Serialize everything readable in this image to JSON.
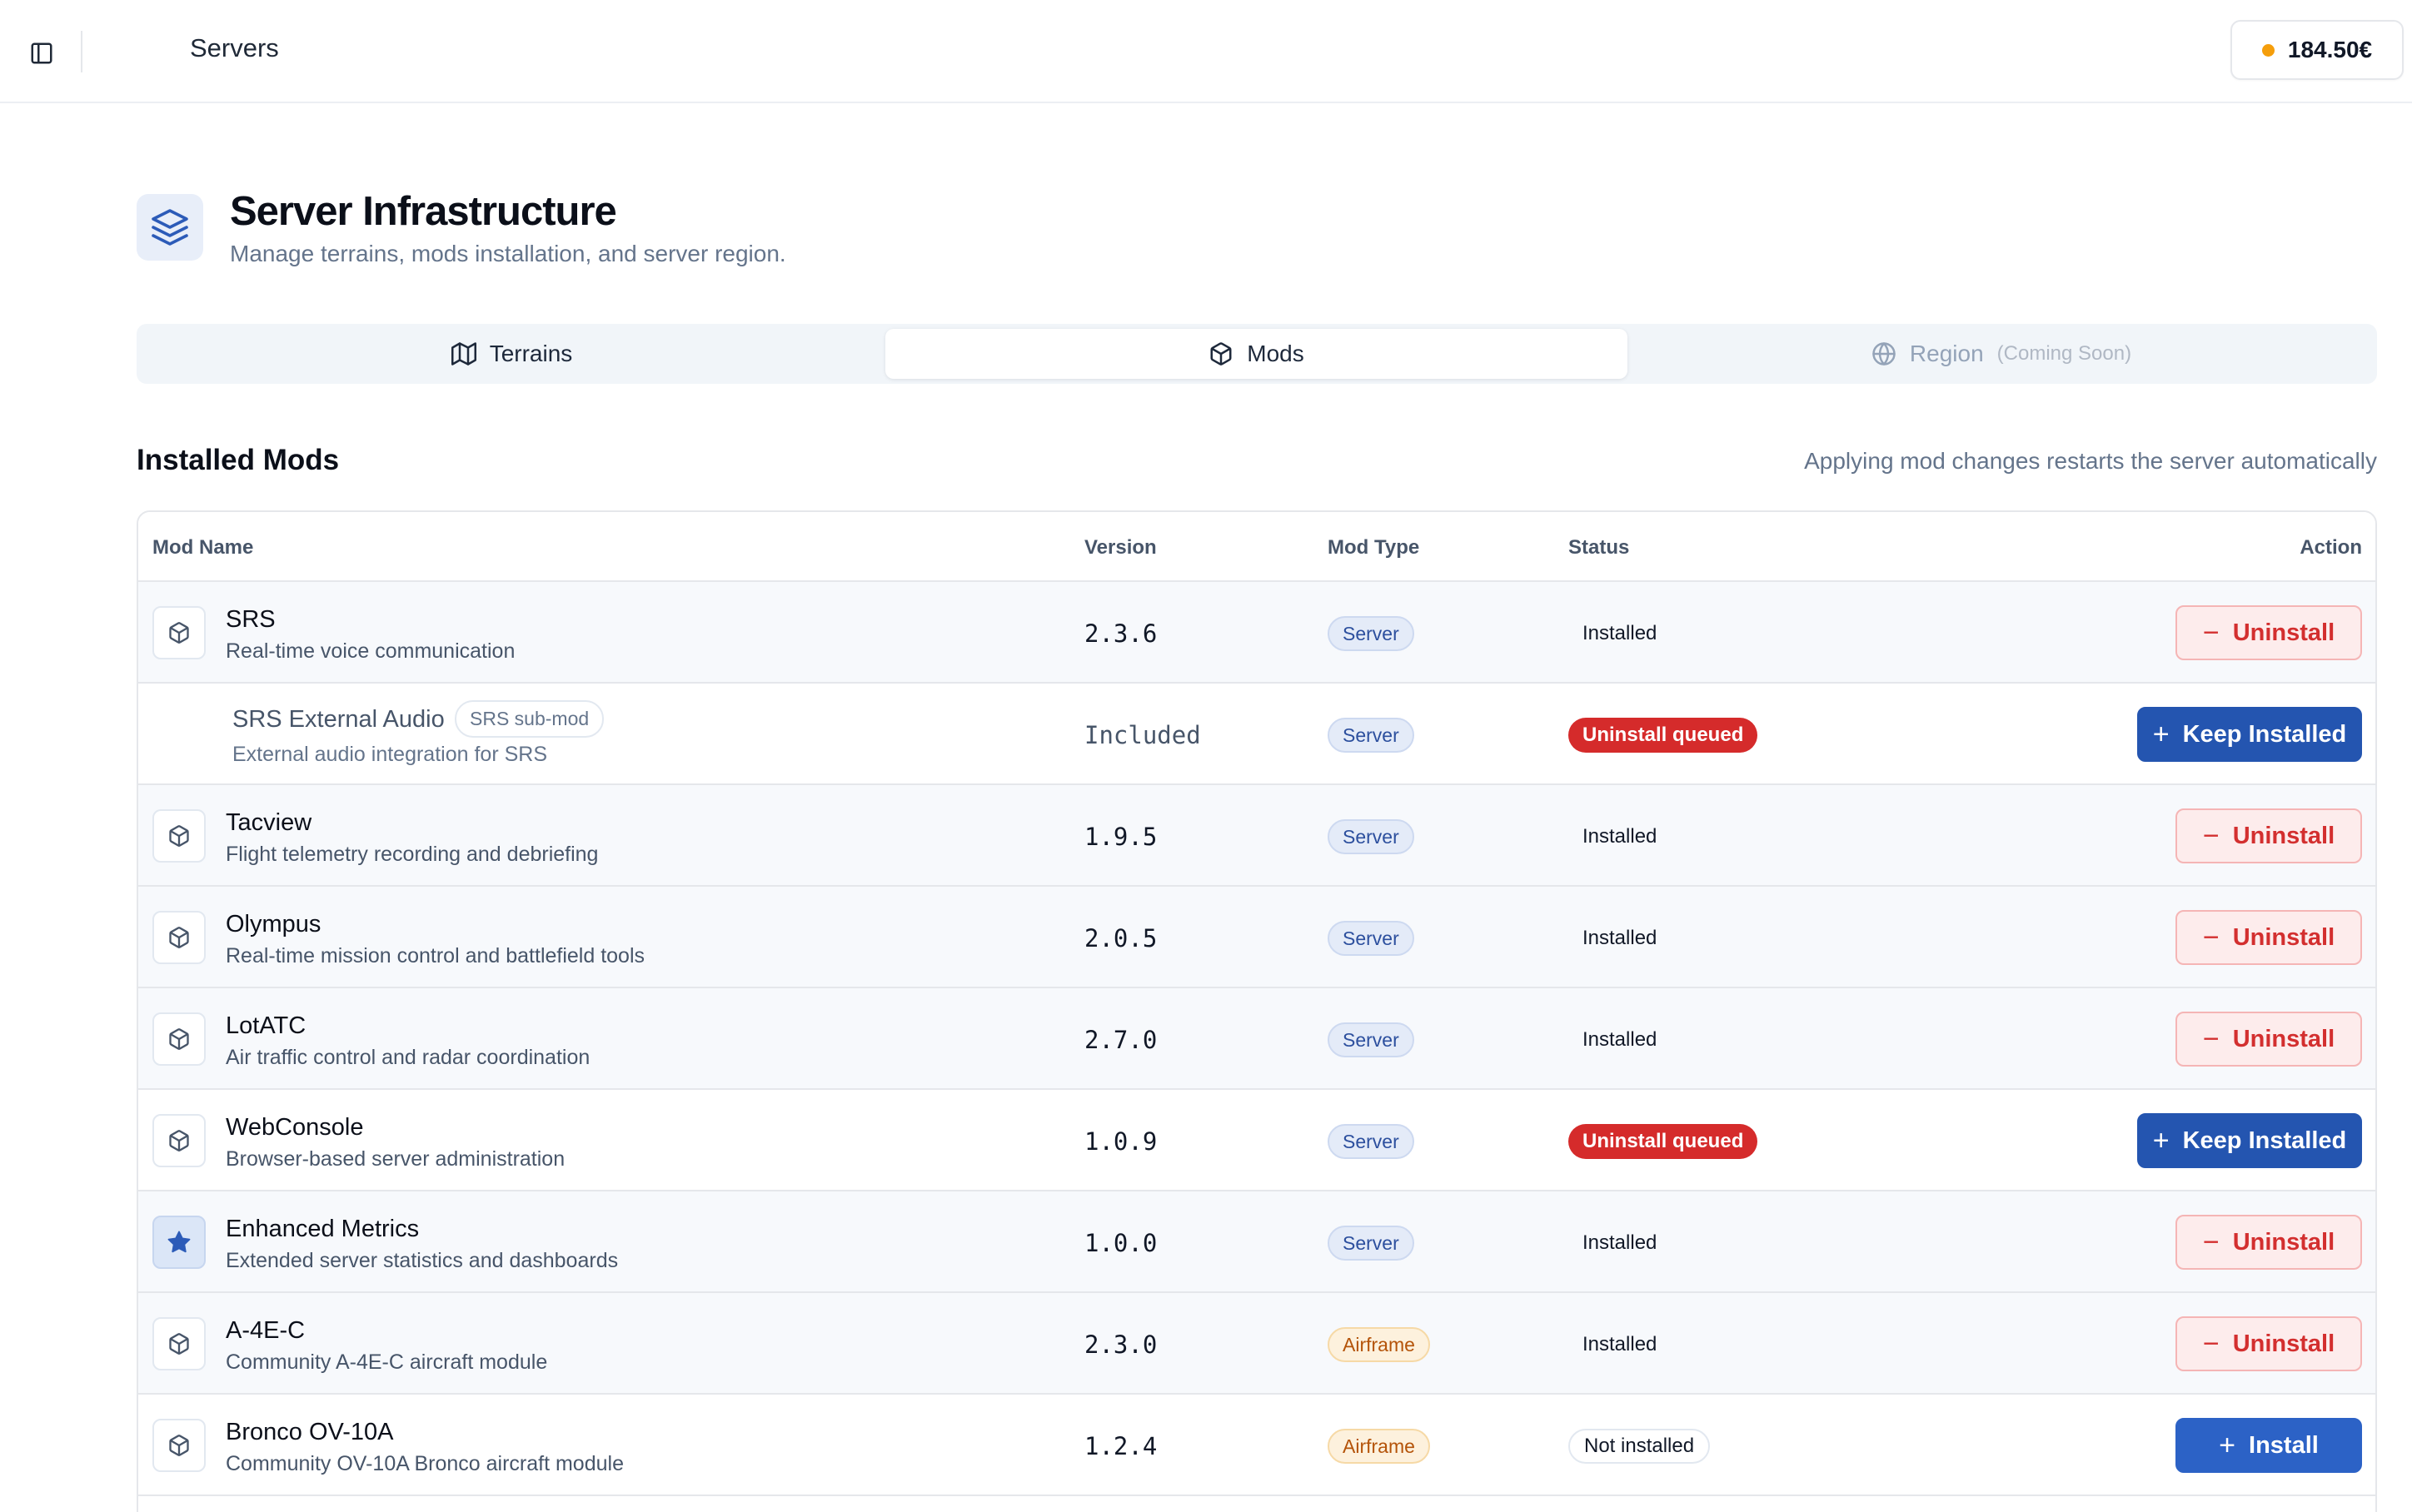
{
  "topbar": {
    "title": "Servers",
    "balance": "184.50€"
  },
  "header": {
    "title": "Server Infrastructure",
    "subtitle": "Manage terrains, mods installation, and server region."
  },
  "tabs": [
    {
      "label": "Terrains",
      "icon": "map-icon",
      "active": false
    },
    {
      "label": "Mods",
      "icon": "package-icon",
      "active": true
    },
    {
      "label": "Region",
      "note": "(Coming Soon)",
      "icon": "globe-icon",
      "active": false,
      "disabled": true
    }
  ],
  "section": {
    "title": "Installed Mods",
    "note": "Applying mod changes restarts the server automatically"
  },
  "table": {
    "headers": {
      "name": "Mod Name",
      "version": "Version",
      "type": "Mod Type",
      "status": "Status",
      "action": "Action"
    },
    "rows": [
      {
        "name": "SRS",
        "desc": "Real-time voice communication",
        "version": "2.3.6",
        "type": "Server",
        "status": "Installed",
        "action": "Uninstall",
        "icon": "package-icon"
      },
      {
        "name": "SRS External Audio",
        "tag": "SRS sub-mod",
        "desc": "External audio integration for SRS",
        "version": "Included",
        "type": "Server",
        "status": "Uninstall queued",
        "action": "Keep Installed"
      },
      {
        "name": "Tacview",
        "desc": "Flight telemetry recording and debriefing",
        "version": "1.9.5",
        "type": "Server",
        "status": "Installed",
        "action": "Uninstall",
        "icon": "package-icon"
      },
      {
        "name": "Olympus",
        "desc": "Real-time mission control and battlefield tools",
        "version": "2.0.5",
        "type": "Server",
        "status": "Installed",
        "action": "Uninstall",
        "icon": "package-icon"
      },
      {
        "name": "LotATC",
        "desc": "Air traffic control and radar coordination",
        "version": "2.7.0",
        "type": "Server",
        "status": "Installed",
        "action": "Uninstall",
        "icon": "package-icon"
      },
      {
        "name": "WebConsole",
        "desc": "Browser-based server administration",
        "version": "1.0.9",
        "type": "Server",
        "status": "Uninstall queued",
        "action": "Keep Installed",
        "icon": "package-icon"
      },
      {
        "name": "Enhanced Metrics",
        "desc": "Extended server statistics and dashboards",
        "version": "1.0.0",
        "type": "Server",
        "status": "Installed",
        "action": "Uninstall",
        "icon": "star-icon"
      },
      {
        "name": "A-4E-C",
        "desc": "Community A-4E-C aircraft module",
        "version": "2.3.0",
        "type": "Airframe",
        "status": "Installed",
        "action": "Uninstall",
        "icon": "package-icon"
      },
      {
        "name": "Bronco OV-10A",
        "desc": "Community OV-10A Bronco aircraft module",
        "version": "1.2.4",
        "type": "Airframe",
        "status": "Not installed",
        "action": "Install",
        "icon": "package-icon"
      }
    ]
  },
  "colors": {
    "accent": "#2455b0",
    "danger": "#d32f2f",
    "balance_dot": "#f59e0b"
  }
}
